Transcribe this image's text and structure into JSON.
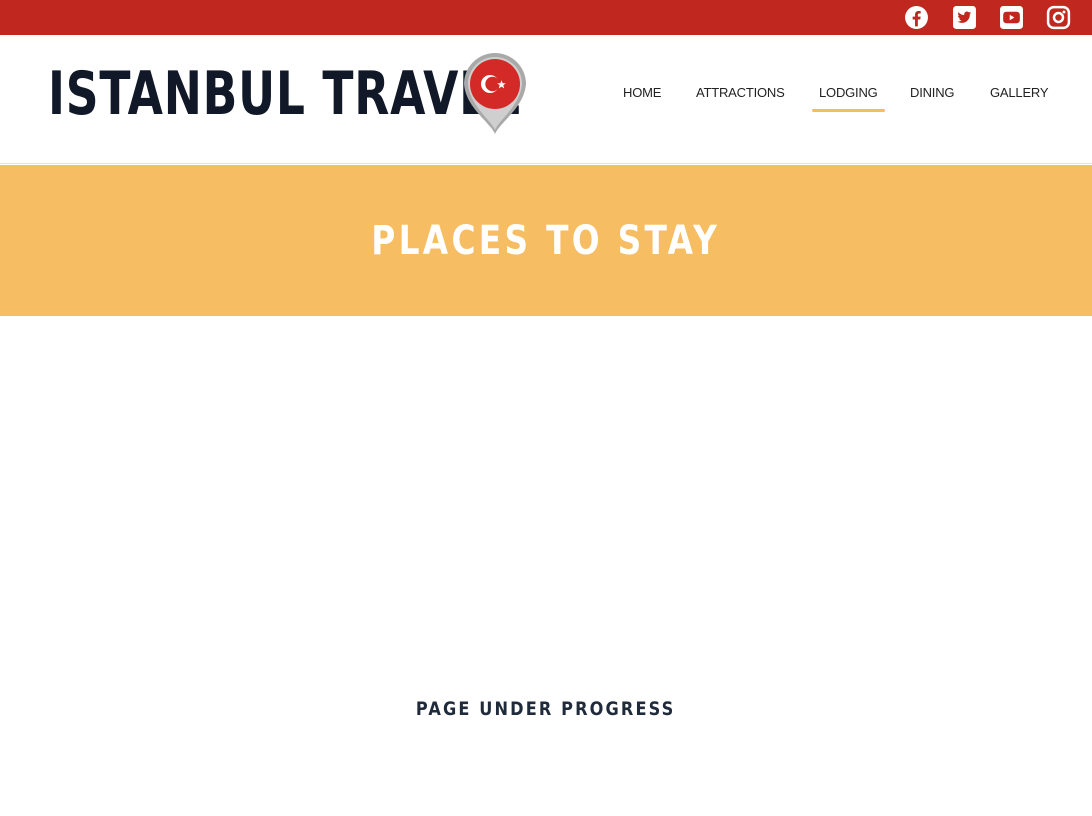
{
  "colors": {
    "topbar": "#c0271e",
    "hero_background": "#f7bd62",
    "active_underline": "#f5bd5f",
    "logo_text": "#111827"
  },
  "social": [
    {
      "icon": "facebook-icon"
    },
    {
      "icon": "twitter-icon"
    },
    {
      "icon": "youtube-icon"
    },
    {
      "icon": "instagram-icon"
    }
  ],
  "logo": {
    "text": "ISTANBUL TRAVEL",
    "icon": "map-pin-turkey-flag-icon"
  },
  "nav": {
    "items": [
      {
        "label": "HOME"
      },
      {
        "label": "ATTRACTIONS"
      },
      {
        "label": "LODGING",
        "active": true
      },
      {
        "label": "DINING"
      },
      {
        "label": "GALLERY"
      }
    ]
  },
  "hero": {
    "title": "PLACES TO STAY"
  },
  "content": {
    "status": "PAGE UNDER PROGRESS"
  }
}
